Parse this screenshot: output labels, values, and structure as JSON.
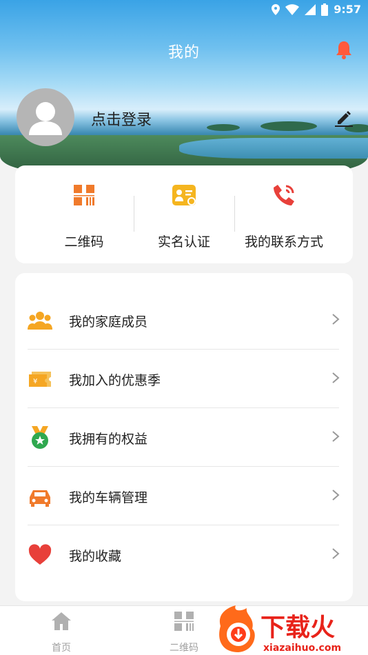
{
  "status_bar": {
    "time": "9:57"
  },
  "header": {
    "title": "我的",
    "login_text": "点击登录"
  },
  "quick_actions": [
    {
      "label": "二维码",
      "icon": "qr-code-icon"
    },
    {
      "label": "实名认证",
      "icon": "id-card-icon"
    },
    {
      "label": "我的联系方式",
      "icon": "phone-icon"
    }
  ],
  "menu": [
    {
      "label": "我的家庭成员",
      "icon": "family-icon"
    },
    {
      "label": "我加入的优惠季",
      "icon": "coupon-icon"
    },
    {
      "label": "我拥有的权益",
      "icon": "medal-icon"
    },
    {
      "label": "我的车辆管理",
      "icon": "car-icon"
    },
    {
      "label": "我的收藏",
      "icon": "heart-icon"
    }
  ],
  "bottom_nav": [
    {
      "label": "首页",
      "icon": "home-icon"
    },
    {
      "label": "二维码",
      "icon": "qr-code-icon"
    }
  ],
  "watermark": {
    "brand": "下载火",
    "url": "xiazaihuo.com"
  },
  "colors": {
    "accent_orange": "#f07a2b",
    "accent_red": "#e8403a",
    "gold": "#f5a623"
  }
}
